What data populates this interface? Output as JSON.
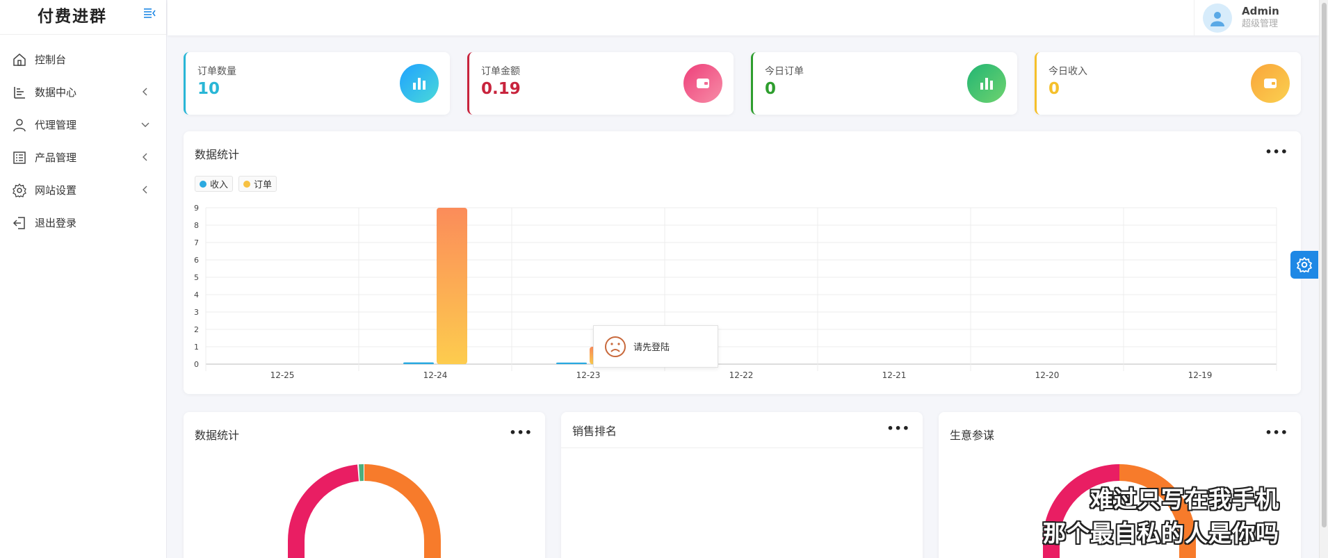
{
  "brand": {
    "title": "付费进群"
  },
  "sidebar": {
    "items": [
      {
        "label": "控制台",
        "icon": "home-icon"
      },
      {
        "label": "数据中心",
        "icon": "chart-bars-icon",
        "arrow": "chevron-left-icon"
      },
      {
        "label": "代理管理",
        "icon": "user-icon",
        "arrow": "chevron-down-icon"
      },
      {
        "label": "产品管理",
        "icon": "list-icon",
        "arrow": "chevron-left-icon"
      },
      {
        "label": "网站设置",
        "icon": "gear-icon",
        "arrow": "chevron-left-icon"
      },
      {
        "label": "退出登录",
        "icon": "logout-icon"
      }
    ]
  },
  "header": {
    "user_name": "Admin",
    "user_role": "超级管理"
  },
  "stats": [
    {
      "label": "订单数量",
      "value": "10",
      "color": "#29b6d6",
      "icon": "bar-chart-icon"
    },
    {
      "label": "订单金额",
      "value": "0.19",
      "color": "#c8243d",
      "icon": "wallet-icon"
    },
    {
      "label": "今日订单",
      "value": "0",
      "color": "#2e9e2e",
      "icon": "bar-chart-icon"
    },
    {
      "label": "今日收入",
      "value": "0",
      "color": "#f5c02b",
      "icon": "wallet-icon"
    }
  ],
  "main_chart": {
    "title": "数据统计",
    "more": "•••",
    "tooltip": "请先登陆"
  },
  "chart_data": {
    "type": "bar",
    "categories": [
      "12-25",
      "12-24",
      "12-23",
      "12-22",
      "12-21",
      "12-20",
      "12-19"
    ],
    "series": [
      {
        "name": "收入",
        "values": [
          0,
          0.1,
          0.09,
          0,
          0,
          0,
          0
        ],
        "color": "#2aa9e0"
      },
      {
        "name": "订单",
        "values": [
          0,
          9,
          1,
          0,
          0,
          0,
          0
        ],
        "color": "#f7c142"
      }
    ],
    "yticks": [
      "0",
      "1",
      "2",
      "3",
      "4",
      "5",
      "6",
      "7",
      "8",
      "9"
    ],
    "ylim": [
      0,
      9
    ],
    "grid": true,
    "legend": "top-left"
  },
  "bottom_panels": [
    {
      "title": "数据统计",
      "more": "•••"
    },
    {
      "title": "销售排名",
      "more": "•••"
    },
    {
      "title": "生意参谋",
      "more": "•••"
    }
  ],
  "subtitles": [
    "难过只写在我手机",
    "那个最自私的人是你吗"
  ]
}
